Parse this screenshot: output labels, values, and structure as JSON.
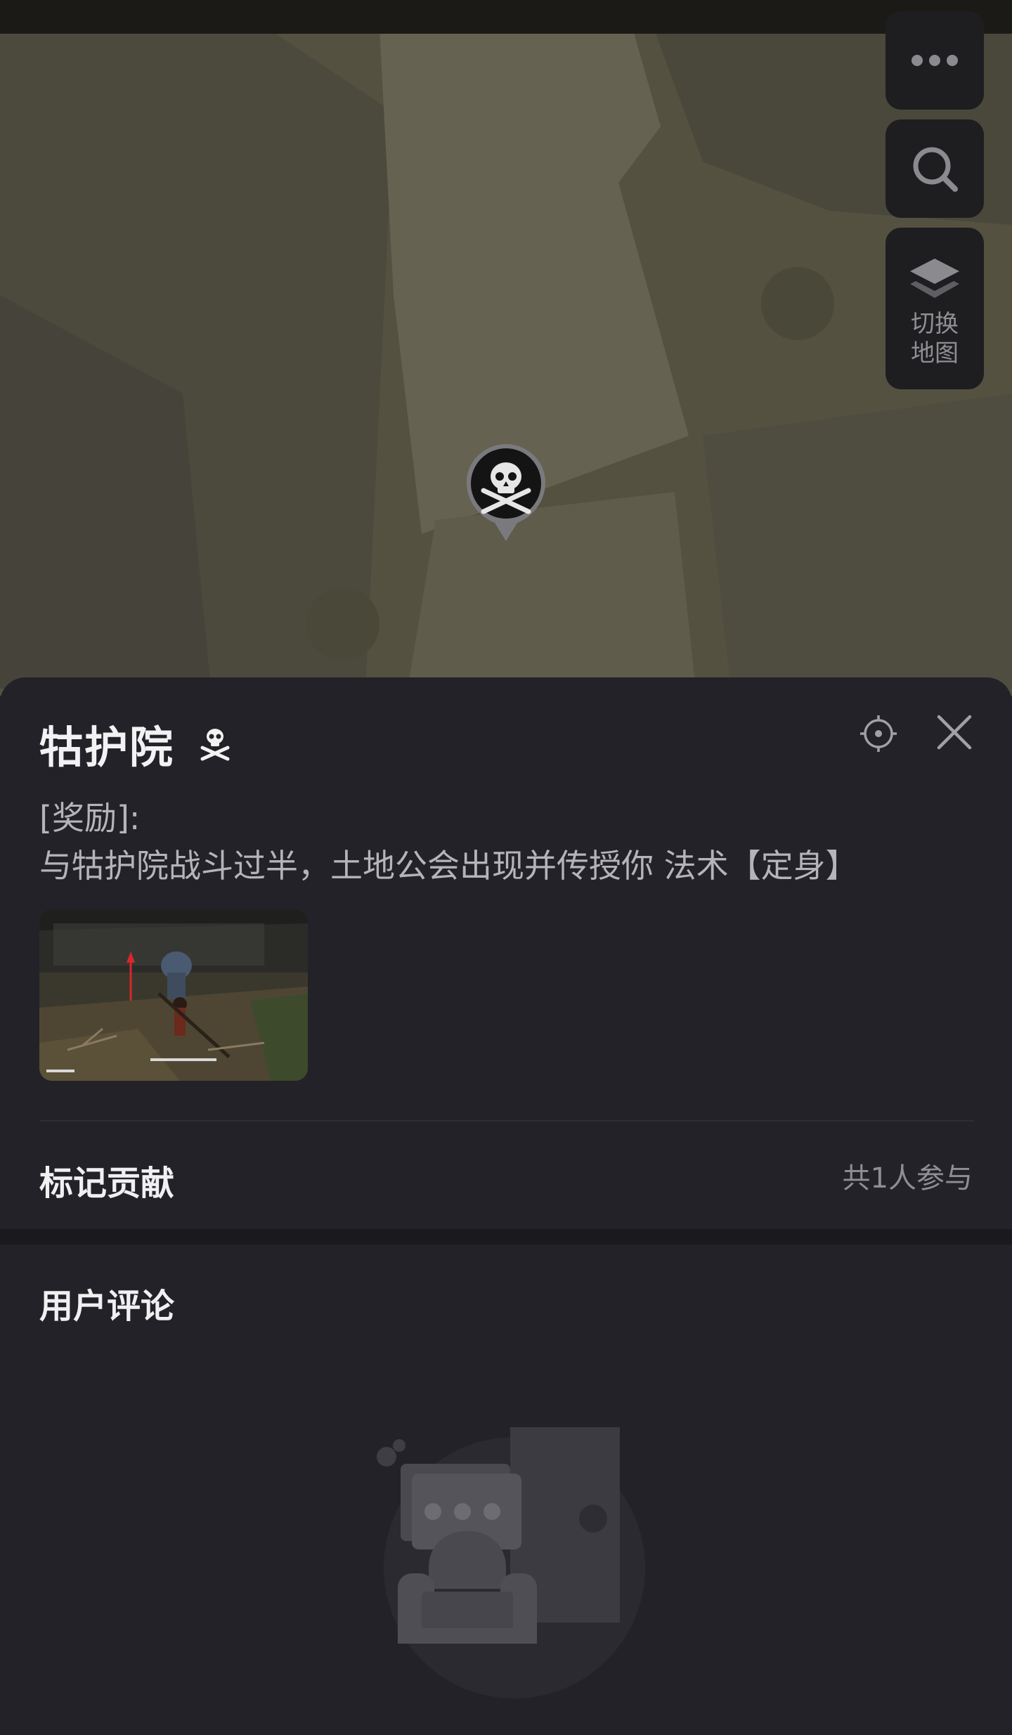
{
  "map": {
    "more_icon": "more-dots-icon",
    "search_icon": "search-icon",
    "layers": {
      "icon": "layers-icon",
      "label": "切换地图"
    },
    "marker_icon": "skull-icon"
  },
  "detail": {
    "title": "牯护院",
    "title_icon": "skull-icon",
    "reward_label": "[奖励]:",
    "reward_text": "与牯护院战斗过半，土地公会出现并传授你 法术【定身】",
    "contribution_label": "标记贡献",
    "contribution_count": "共1人参与"
  },
  "comments": {
    "title": "用户评论",
    "empty_icon": "empty-comments-illustration"
  },
  "colors": {
    "map_bg": "#545141",
    "sheet_bg": "#232228",
    "button_bg": "#1e1e21",
    "text_primary": "#f0f0f2",
    "text_secondary": "#b4b4b9",
    "text_muted": "#8e8e93"
  }
}
